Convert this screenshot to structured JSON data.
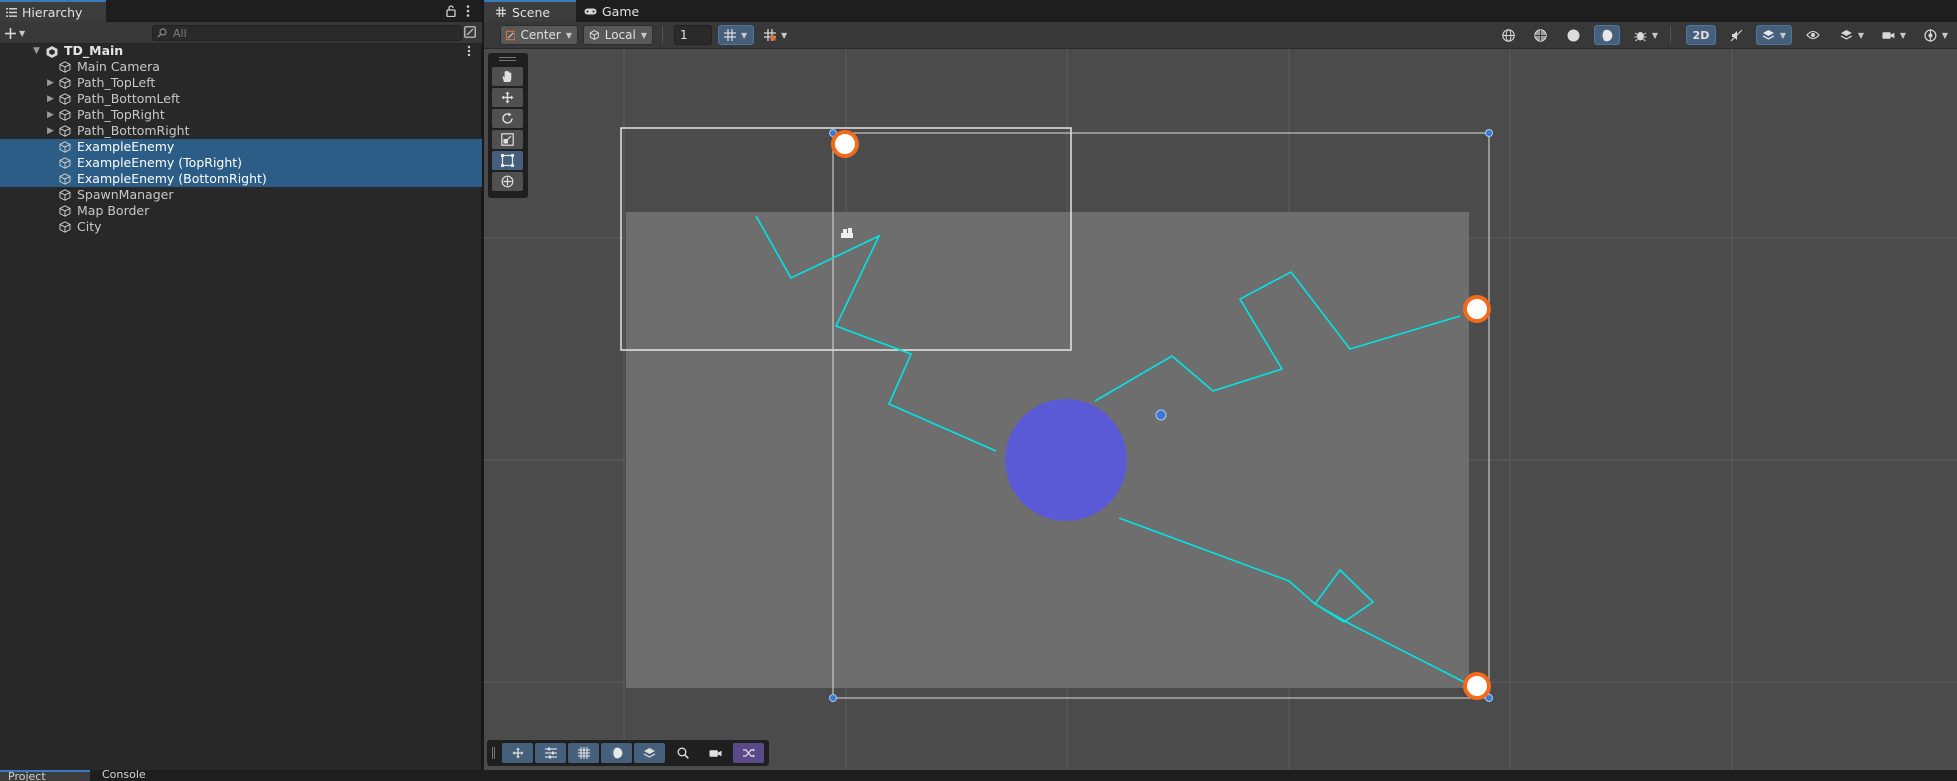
{
  "hierarchy": {
    "tab_label": "Hierarchy",
    "search_placeholder": "All",
    "scene_name": "TD_Main",
    "items": [
      {
        "label": "Main Camera",
        "foldout": false,
        "selected": false
      },
      {
        "label": "Path_TopLeft",
        "foldout": true,
        "selected": false
      },
      {
        "label": "Path_BottomLeft",
        "foldout": true,
        "selected": false
      },
      {
        "label": "Path_TopRight",
        "foldout": true,
        "selected": false
      },
      {
        "label": "Path_BottomRight",
        "foldout": true,
        "selected": false
      },
      {
        "label": "ExampleEnemy",
        "foldout": false,
        "selected": true
      },
      {
        "label": "ExampleEnemy (TopRight)",
        "foldout": false,
        "selected": true
      },
      {
        "label": "ExampleEnemy (BottomRight)",
        "foldout": false,
        "selected": true
      },
      {
        "label": "SpawnManager",
        "foldout": false,
        "selected": false
      },
      {
        "label": "Map Border",
        "foldout": false,
        "selected": false
      },
      {
        "label": "City",
        "foldout": false,
        "selected": false
      }
    ]
  },
  "scene_view": {
    "tabs": {
      "scene": "Scene",
      "game": "Game"
    },
    "toolbar": {
      "pivot": "Center",
      "space": "Local",
      "grid_snap_value": "1",
      "mode_2d": "2D"
    },
    "tools": [
      "view-tool",
      "move-tool",
      "rotate-tool",
      "scale-tool",
      "rect-tool",
      "transform-tool"
    ],
    "active_tool": "rect-tool",
    "overlays": [
      "move-overlay",
      "settings-overlay",
      "grid-overlay",
      "lighting-overlay",
      "layers-overlay",
      "search-overlay",
      "camera-overlay",
      "shuffle-overlay"
    ]
  },
  "bottom": {
    "project_tab": "Project",
    "console_tab": "Console"
  },
  "colors": {
    "accent": "#3a79bb",
    "selection": "#2c5d87",
    "path": "#00e5e5",
    "city": "#5a5ad6",
    "enemy_ring": "#f26a1b",
    "map_area": "#6e6e6e"
  }
}
